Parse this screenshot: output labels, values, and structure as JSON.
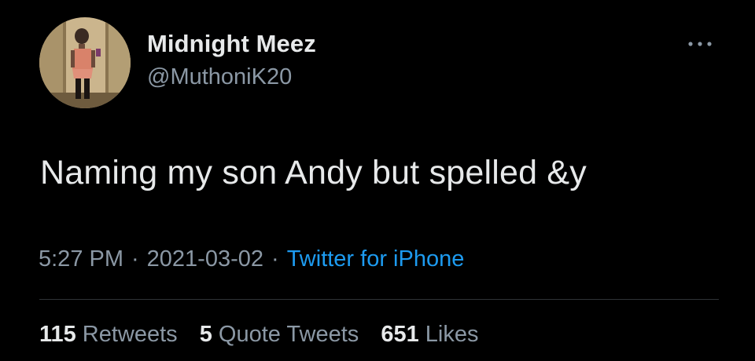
{
  "user": {
    "display_name": "Midnight Meez",
    "handle": "@MuthoniK20",
    "avatar_icon": "profile-photo"
  },
  "tweet": {
    "text": "Naming my son Andy but spelled &y",
    "time": "5:27 PM",
    "date": "2021-03-02",
    "source": "Twitter for iPhone",
    "separator": "·"
  },
  "stats": {
    "retweets_count": "115",
    "retweets_label": "Retweets",
    "quote_count": "5",
    "quote_label": "Quote Tweets",
    "likes_count": "651",
    "likes_label": "Likes"
  },
  "menu": {
    "more_icon": "more-horizontal-icon"
  },
  "colors": {
    "background": "#000000",
    "primary_text": "#e7e9ea",
    "secondary_text": "#8b98a5",
    "link": "#1d9bf0",
    "divider": "#2f3336"
  }
}
